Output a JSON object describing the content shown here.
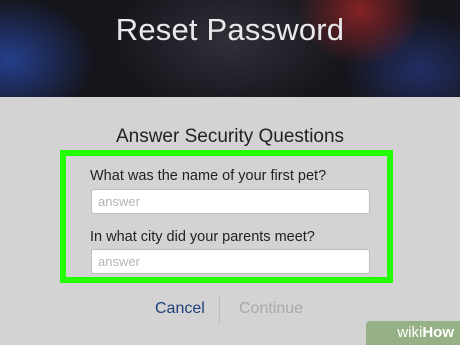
{
  "header": {
    "title": "Reset Password"
  },
  "form": {
    "title": "Answer Security Questions",
    "questions": [
      {
        "label": "What was the name of your first pet?",
        "placeholder": "answer",
        "value": ""
      },
      {
        "label": "In what city did your parents meet?",
        "placeholder": "answer",
        "value": ""
      }
    ],
    "highlight_color": "#22ff00"
  },
  "actions": {
    "cancel_label": "Cancel",
    "continue_label": "Continue"
  },
  "watermark": {
    "part1": "wiki",
    "part2": "How"
  }
}
